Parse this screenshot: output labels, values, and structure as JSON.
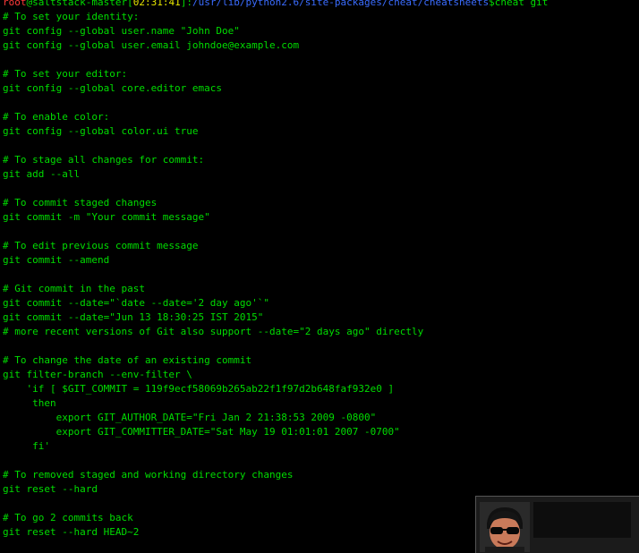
{
  "prompt": {
    "user": "root",
    "host": "@saltstack-master",
    "time": "02:31:41",
    "path": "/usr/lib/python2.6/site-packages/cheat/cheatsheets",
    "symbol": "$",
    "command": "cheat git"
  },
  "lines": [
    "# To set your identity:",
    "git config --global user.name \"John Doe\"",
    "git config --global user.email johndoe@example.com",
    "",
    "# To set your editor:",
    "git config --global core.editor emacs",
    "",
    "# To enable color:",
    "git config --global color.ui true",
    "",
    "# To stage all changes for commit:",
    "git add --all",
    "",
    "# To commit staged changes",
    "git commit -m \"Your commit message\"",
    "",
    "# To edit previous commit message",
    "git commit --amend",
    "",
    "# Git commit in the past",
    "git commit --date=\"`date --date='2 day ago'`\"",
    "git commit --date=\"Jun 13 18:30:25 IST 2015\"",
    "# more recent versions of Git also support --date=\"2 days ago\" directly",
    "",
    "# To change the date of an existing commit",
    "git filter-branch --env-filter \\",
    "    'if [ $GIT_COMMIT = 119f9ecf58069b265ab22f1f97d2b648faf932e0 ]",
    "     then",
    "         export GIT_AUTHOR_DATE=\"Fri Jan 2 21:38:53 2009 -0800\"",
    "         export GIT_COMMITTER_DATE=\"Sat May 19 01:01:01 2007 -0700\"",
    "     fi'",
    "",
    "# To removed staged and working directory changes",
    "git reset --hard",
    "",
    "# To go 2 commits back",
    "git reset --hard HEAD~2"
  ],
  "colors": {
    "background": "#000000",
    "text": "#00dd00",
    "user": "#ff3a3a",
    "time": "#e8e800",
    "path": "#3a6cff"
  }
}
